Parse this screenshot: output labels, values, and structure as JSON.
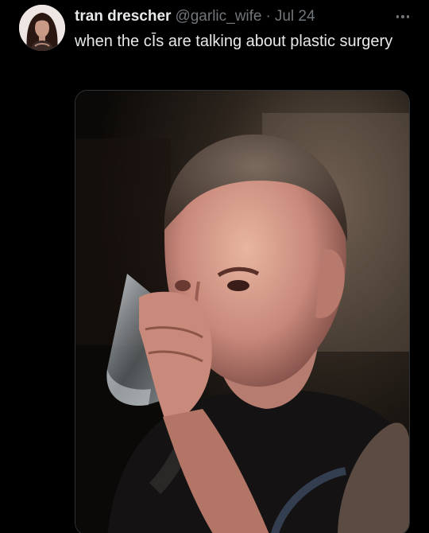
{
  "tweet": {
    "display_name": "tran drescher",
    "handle": "@garlic_wife",
    "separator": "·",
    "date": "Jul 24",
    "text": "when the cĪs are talking about plastic surgery",
    "avatar_icon": "profile-avatar",
    "more_icon": "more-options-icon",
    "media_description": "photo-man-drinking-water"
  },
  "colors": {
    "background": "#000000",
    "primary_text": "#e7e9ea",
    "secondary_text": "#71767b",
    "border": "#2f3336"
  }
}
